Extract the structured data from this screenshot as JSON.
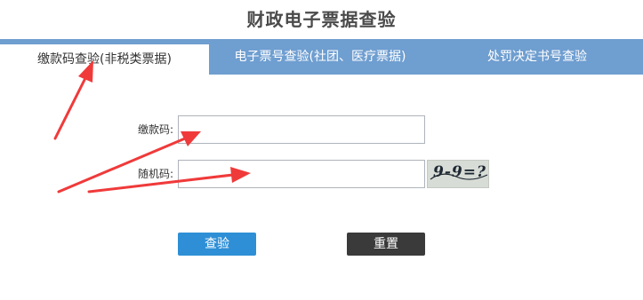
{
  "page": {
    "title": "财政电子票据查验"
  },
  "tabs": [
    {
      "label": "缴款码查验(非税类票据)",
      "active": true
    },
    {
      "label": "电子票号查验(社团、医疗票据)",
      "active": false
    },
    {
      "label": "处罚决定书号查验",
      "active": false
    }
  ],
  "form": {
    "payment_code_label": "缴款码:",
    "payment_code_value": "",
    "random_code_label": "随机码:",
    "random_code_value": "",
    "captcha_text": "9-9=?"
  },
  "buttons": {
    "query_label": "查验",
    "reset_label": "重置"
  },
  "colors": {
    "tab_bar": "#6f9ed0",
    "query_button": "#2e8fd6",
    "reset_button": "#3a3a3a",
    "annotation_arrow": "#f03a3a"
  }
}
